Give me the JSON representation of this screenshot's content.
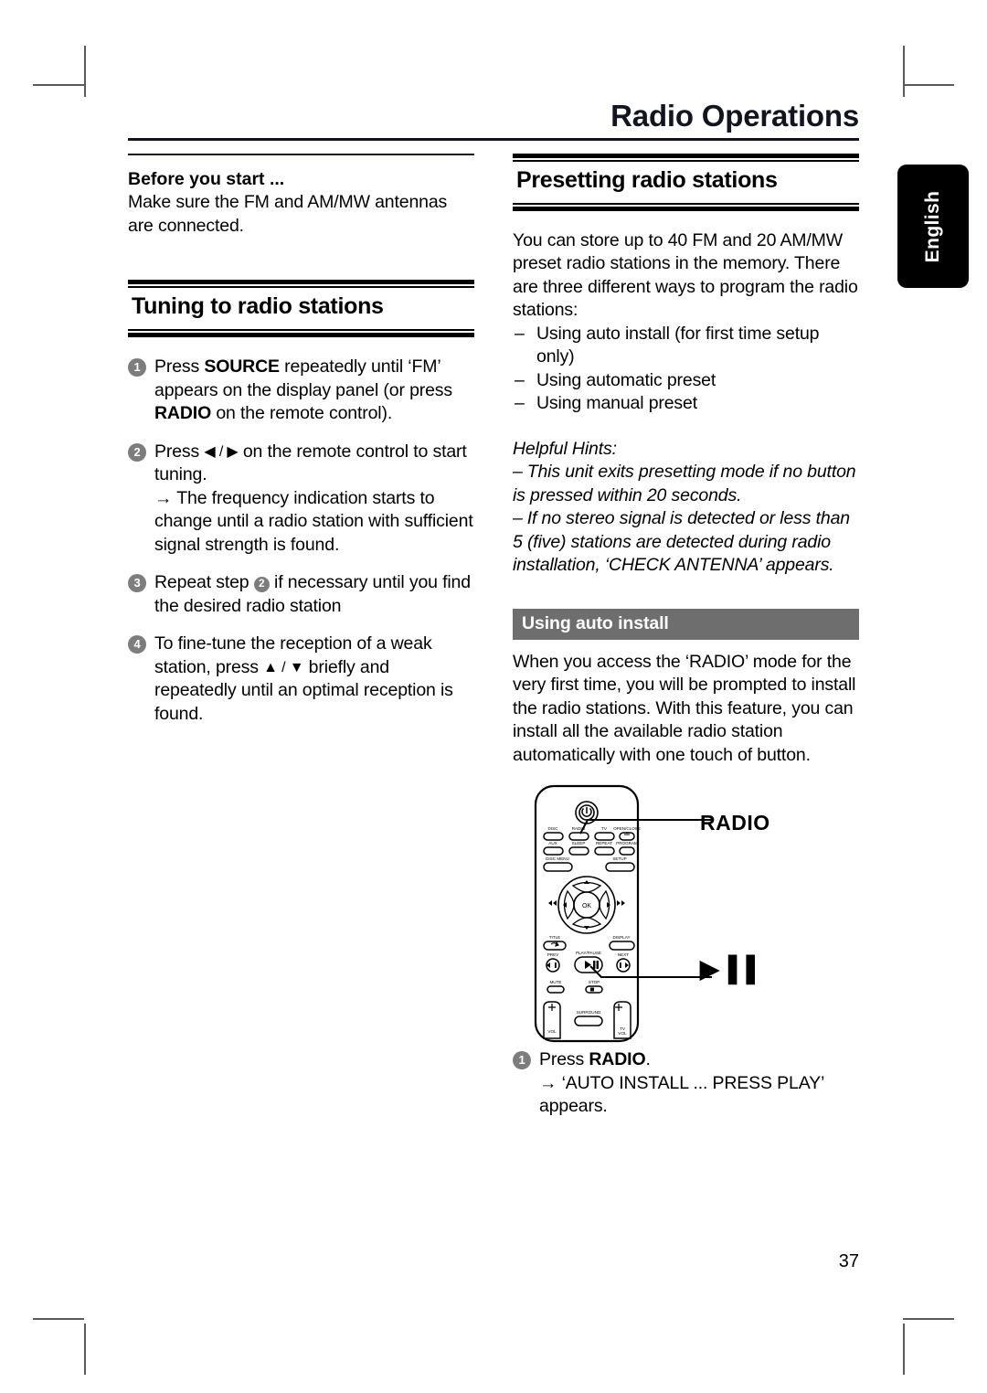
{
  "running_head": "Radio Operations",
  "language_tab": "English",
  "folio": "37",
  "left_column": {
    "before_you_start": {
      "heading": "Before you start ...",
      "text": "Make sure the FM and AM/MW antennas are connected."
    },
    "section": {
      "title": "Tuning to radio stations"
    },
    "steps": [
      {
        "number": "1",
        "parts": [
          {
            "text": "Press "
          },
          {
            "text": "SOURCE",
            "bold": true
          },
          {
            "text": " repeatedly until ‘FM’ appears on the display panel (or press "
          },
          {
            "text": "RADIO",
            "bold": true
          },
          {
            "text": " on the remote control)."
          }
        ]
      },
      {
        "number": "2",
        "parts": [
          {
            "text": "Press "
          },
          {
            "text": "◀ / ▶",
            "glyph": true
          },
          {
            "text": " on the remote control to start tuning."
          }
        ],
        "result": "→ The frequency indication starts to change until a radio station with sufficient signal strength is found."
      },
      {
        "number": "3",
        "parts": [
          {
            "text": "Repeat step "
          },
          {
            "text": "2",
            "inline_num": true
          },
          {
            "text": " if necessary until you find the desired radio station"
          }
        ]
      },
      {
        "number": "4",
        "parts": [
          {
            "text": "To fine-tune the reception of a weak station, press "
          },
          {
            "text": "▲ / ▼",
            "glyph": true
          },
          {
            "text": " briefly and repeatedly until an optimal reception is found."
          }
        ]
      }
    ]
  },
  "right_column": {
    "section": {
      "title": "Presetting radio stations"
    },
    "intro": "You can store up to 40 FM and 20 AM/MW preset radio stations in the memory. There are three different ways to program the radio stations:",
    "methods": [
      "Using auto install (for first time setup only)",
      "Using automatic preset",
      "Using manual preset"
    ],
    "hints": {
      "title": "Helpful Hints:",
      "items": [
        "This unit exits presetting mode if no button is pressed within 20 seconds.",
        "If no stereo signal is detected or less than 5 (five) stations are detected during radio installation, ‘CHECK ANTENNA’ appears."
      ]
    },
    "bar_heading": "Using auto install",
    "auto_install_text": "When you access the ‘RADIO’ mode for the very first time, you will be prompted to install the radio stations.  With this feature, you can install all the available radio station automatically with one touch of button.",
    "figure": {
      "callout_radio": "RADIO",
      "callout_play": "▶▐▐",
      "remote_buttons": [
        "DISC",
        "RADIO",
        "TV",
        "OPEN/CLOSE",
        "AUX",
        "SLEEP",
        "REPEAT",
        "PROGRAM",
        "DISC MENU",
        "SETUP",
        "OK",
        "TITLE",
        "DISPLAY",
        "PREV",
        "PLAY/PAUSE",
        "NEXT",
        "MUTE",
        "STOP",
        "VOL",
        "SURROUND",
        "TV VOL"
      ]
    },
    "final_step": {
      "number": "1",
      "parts": [
        {
          "text": "Press "
        },
        {
          "text": "RADIO",
          "bold": true
        },
        {
          "text": "."
        }
      ],
      "result": "→ ‘AUTO INSTALL ... PRESS PLAY’ appears."
    }
  }
}
